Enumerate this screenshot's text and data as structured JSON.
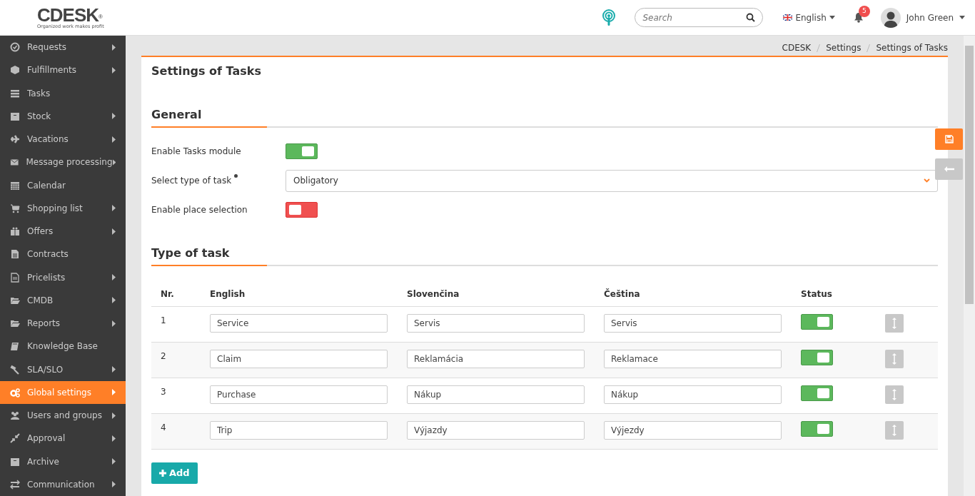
{
  "header": {
    "logo": "CDESK",
    "logo_mark": "®",
    "tagline": "Organized work makes profit",
    "search": {
      "placeholder": "Search"
    },
    "language": "English",
    "notifications": "5",
    "user": "John Green"
  },
  "sidebar": {
    "items": [
      {
        "label": "Requests",
        "submenu": true,
        "selected": false
      },
      {
        "label": "Fulfillments",
        "submenu": true,
        "selected": false
      },
      {
        "label": "Tasks",
        "submenu": false,
        "selected": false
      },
      {
        "label": "Stock",
        "submenu": true,
        "selected": false
      },
      {
        "label": "Vacations",
        "submenu": true,
        "selected": false
      },
      {
        "label": "Message processing",
        "submenu": true,
        "selected": false
      },
      {
        "label": "Calendar",
        "submenu": false,
        "selected": false
      },
      {
        "label": "Shopping list",
        "submenu": true,
        "selected": false
      },
      {
        "label": "Offers",
        "submenu": true,
        "selected": false
      },
      {
        "label": "Contracts",
        "submenu": false,
        "selected": false
      },
      {
        "label": "Pricelists",
        "submenu": true,
        "selected": false
      },
      {
        "label": "CMDB",
        "submenu": true,
        "selected": false
      },
      {
        "label": "Reports",
        "submenu": true,
        "selected": false
      },
      {
        "label": "Knowledge Base",
        "submenu": false,
        "selected": false
      },
      {
        "label": "SLA/SLO",
        "submenu": true,
        "selected": false
      },
      {
        "label": "Global settings",
        "submenu": true,
        "selected": true
      },
      {
        "label": "Users and groups",
        "submenu": true,
        "selected": false
      },
      {
        "label": "Approval",
        "submenu": true,
        "selected": false
      },
      {
        "label": "Archive",
        "submenu": true,
        "selected": false
      },
      {
        "label": "Communication",
        "submenu": true,
        "selected": false
      }
    ]
  },
  "breadcrumb": [
    "CDESK",
    "Settings",
    "Settings of Tasks"
  ],
  "page_title": "Settings of Tasks",
  "general": {
    "title": "General",
    "fields": [
      {
        "kind": "switch",
        "label": "Enable Tasks module",
        "on": true
      },
      {
        "kind": "select",
        "label": "Select type of task",
        "required": true,
        "value": "Obligatory"
      },
      {
        "kind": "switch",
        "label": "Enable place selection",
        "on": false
      }
    ]
  },
  "task_types": {
    "title": "Type of task",
    "columns": [
      "Nr.",
      "English",
      "Slovenčina",
      "Čeština",
      "Status"
    ],
    "rows": [
      {
        "nr": "1",
        "values": [
          "Service",
          "Servis",
          "Servis"
        ],
        "on": true
      },
      {
        "nr": "2",
        "values": [
          "Claim",
          "Reklamácia",
          "Reklamace"
        ],
        "on": true
      },
      {
        "nr": "3",
        "values": [
          "Purchase",
          "Nákup",
          "Nákup"
        ],
        "on": true
      },
      {
        "nr": "4",
        "values": [
          "Trip",
          "Výjazdy",
          "Výjezdy"
        ],
        "on": true
      }
    ],
    "add_button": "Add"
  }
}
